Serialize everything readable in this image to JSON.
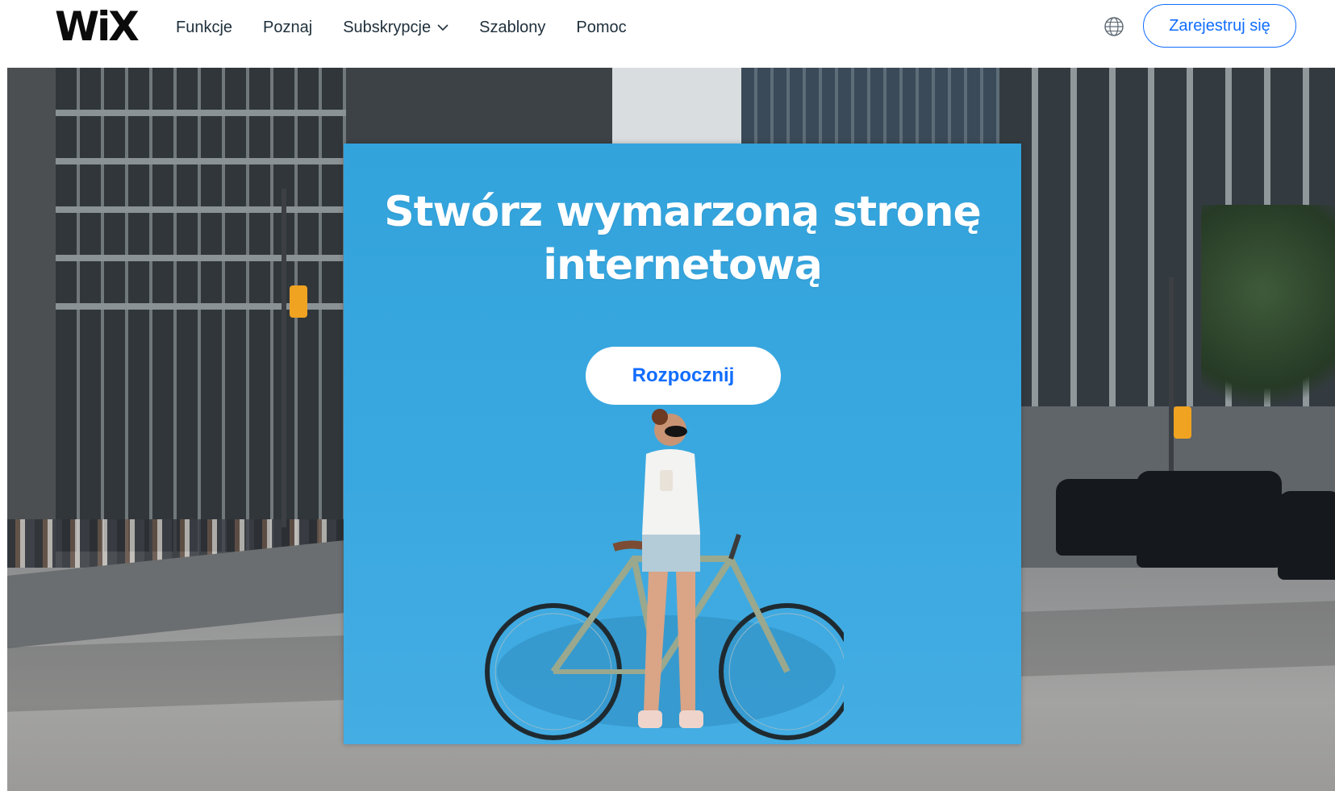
{
  "header": {
    "logo": "WiX",
    "nav": [
      {
        "label": "Funkcje"
      },
      {
        "label": "Poznaj"
      },
      {
        "label": "Subskrypcje",
        "has_dropdown": true
      },
      {
        "label": "Szablony"
      },
      {
        "label": "Pomoc"
      }
    ],
    "language_icon": "globe-icon",
    "signup_label": "Zarejestruj się"
  },
  "hero": {
    "headline_line1": "Stwórz wymarzoną stronę",
    "headline_line2": "internetową",
    "cta_label": "Rozpocznij"
  },
  "colors": {
    "brand_blue": "#116dff",
    "panel_blue": "#3aa8e0",
    "text_dark": "#20303c"
  }
}
